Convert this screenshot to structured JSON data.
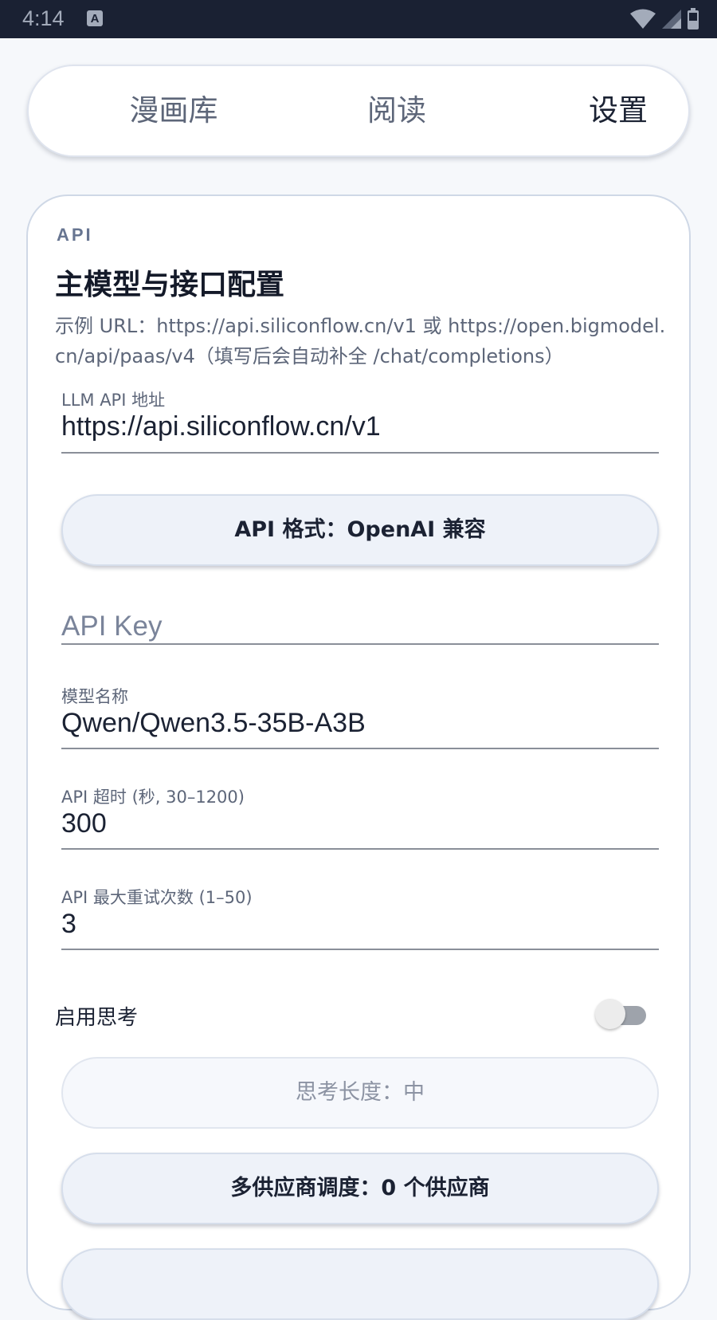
{
  "status_bar": {
    "time": "4:14",
    "notification_icon_letter": "A",
    "icons": [
      "wifi-icon",
      "cellular-signal-icon",
      "battery-icon"
    ]
  },
  "nav": {
    "tabs": [
      {
        "label": "漫画库",
        "selected": false
      },
      {
        "label": "阅读",
        "selected": false
      },
      {
        "label": "设置",
        "selected": true
      }
    ]
  },
  "api_section": {
    "tag": "API",
    "title": "主模型与接口配置",
    "hint": "示例 URL：https://api.siliconflow.cn/v1 或 https://open.bigmodel.cn/api/paas/v4（填写后会自动补全 /chat/completions）",
    "llm_url": {
      "label": "LLM API 地址",
      "value": "https://api.siliconflow.cn/v1"
    },
    "api_format_button": "API 格式：OpenAI 兼容",
    "api_key": {
      "placeholder": "API Key",
      "value": ""
    },
    "model_name": {
      "label": "模型名称",
      "value": "Qwen/Qwen3.5-35B-A3B"
    },
    "timeout": {
      "label": "API 超时 (秒, 30–1200)",
      "value": "300"
    },
    "max_retries": {
      "label": "API 最大重试次数 (1–50)",
      "value": "3"
    },
    "thinking_toggle": {
      "label": "启用思考",
      "enabled": false
    },
    "thinking_length_button": "思考长度：中",
    "multi_provider_button": "多供应商调度：0 个供应商"
  },
  "colors": {
    "status_bar_bg": "#1a2133",
    "page_bg": "#f6f8fb",
    "card_border": "#cfd8e6",
    "button_bg": "#eef2f9",
    "text_primary": "#1b2233",
    "text_secondary": "#5d6679"
  }
}
